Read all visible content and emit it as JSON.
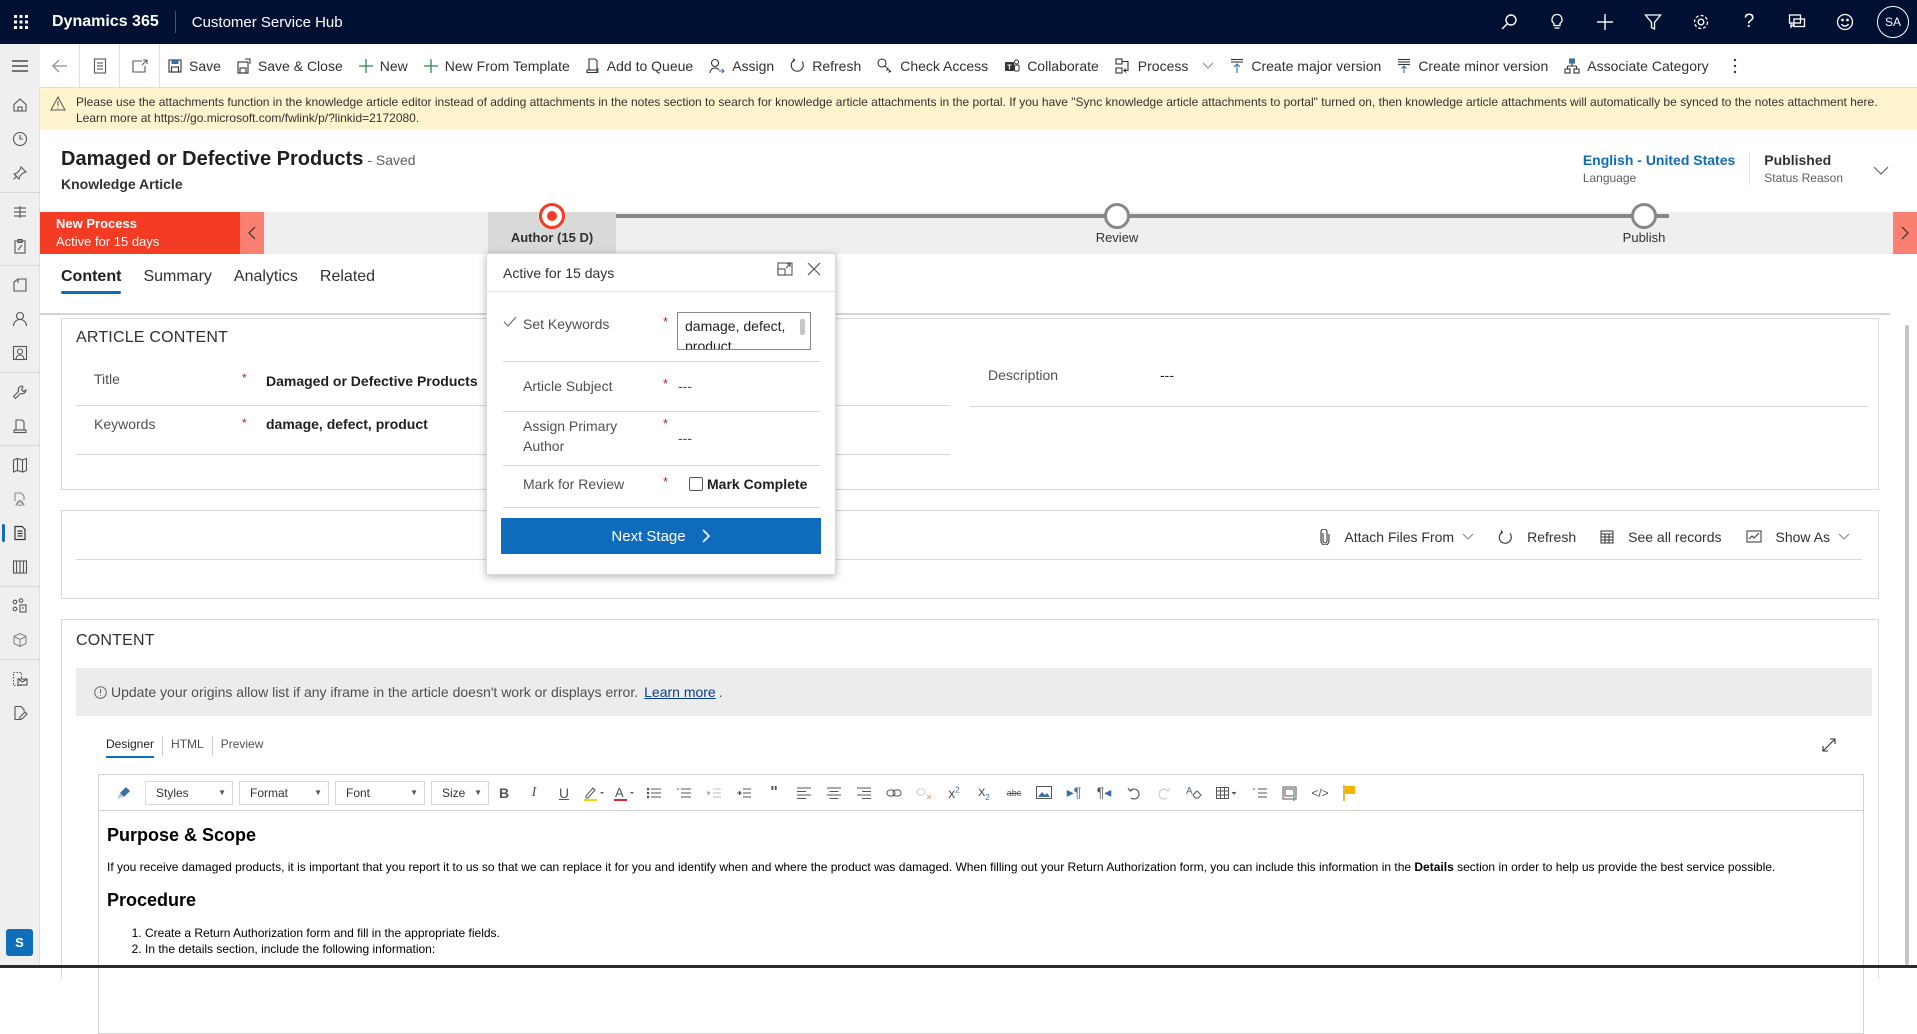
{
  "topbar": {
    "brand": "Dynamics 365",
    "app_name": "Customer Service Hub",
    "icons": [
      "search-icon",
      "lightbulb-icon",
      "plus-icon",
      "filter-icon",
      "gear-icon",
      "help-icon",
      "chat-icon",
      "smiley-icon"
    ],
    "avatar_initials": "SA"
  },
  "command_bar": {
    "items": [
      {
        "label": "Save",
        "icon": "save-icon"
      },
      {
        "label": "Save & Close",
        "icon": "save-close-icon"
      },
      {
        "label": "New",
        "icon": "plus-icon"
      },
      {
        "label": "New From Template",
        "icon": "plus-icon"
      },
      {
        "label": "Add to Queue",
        "icon": "add-queue-icon"
      },
      {
        "label": "Assign",
        "icon": "assign-icon"
      },
      {
        "label": "Refresh",
        "icon": "refresh-icon"
      },
      {
        "label": "Check Access",
        "icon": "key-icon"
      },
      {
        "label": "Collaborate",
        "icon": "teams-icon"
      },
      {
        "label": "Process",
        "icon": "process-icon"
      },
      {
        "label": "Create major version",
        "icon": "major-version-icon"
      },
      {
        "label": "Create minor version",
        "icon": "minor-version-icon"
      },
      {
        "label": "Associate Category",
        "icon": "category-icon"
      }
    ]
  },
  "banner": {
    "line1": "Please use the attachments function in the knowledge article editor instead of adding attachments in the notes section to search for knowledge article attachments in the portal. If you have \"Sync knowledge article attachments to portal\" turned on, then knowledge article attachments will automatically be synced to the notes attachment here.",
    "line2": "Learn more at https://go.microsoft.com/fwlink/p/?linkid=2172080."
  },
  "header": {
    "title": "Damaged or Defective Products",
    "saved_status": "- Saved",
    "entity": "Knowledge Article",
    "language_value": "English - United States",
    "language_label": "Language",
    "status_value": "Published",
    "status_label": "Status Reason"
  },
  "process": {
    "name": "New Process",
    "duration": "Active for 15 days",
    "stages": [
      {
        "label": "Author  (15 D)",
        "state": "active"
      },
      {
        "label": "Review",
        "state": "pending"
      },
      {
        "label": "Publish",
        "state": "pending"
      }
    ]
  },
  "tabs": [
    {
      "label": "Content",
      "active": true
    },
    {
      "label": "Summary",
      "active": false
    },
    {
      "label": "Analytics",
      "active": false
    },
    {
      "label": "Related",
      "active": false
    }
  ],
  "article_content": {
    "section_title": "ARTICLE CONTENT",
    "fields": [
      {
        "label": "Title",
        "required": "*",
        "value": "Damaged or Defective Products"
      },
      {
        "label": "Keywords",
        "required": "*",
        "value": "damage, defect, product"
      }
    ],
    "description_label": "Description",
    "description_value": "---"
  },
  "attachments_subgrid": {
    "commands": [
      {
        "label": "Attach Files From",
        "icon": "paperclip-icon",
        "has_dropdown": true
      },
      {
        "label": "Refresh",
        "icon": "refresh-icon",
        "has_dropdown": false
      },
      {
        "label": "See all records",
        "icon": "grid-icon",
        "has_dropdown": false
      },
      {
        "label": "Show As",
        "icon": "chart-icon",
        "has_dropdown": true
      }
    ]
  },
  "content_section": {
    "title": "CONTENT",
    "notice_text": "Update your origins allow list if any iframe in the article doesn't work or displays error.",
    "notice_link": "Learn more",
    "notice_suffix": ".",
    "editor_tabs": [
      {
        "label": "Designer",
        "active": true
      },
      {
        "label": "HTML",
        "active": false
      },
      {
        "label": "Preview",
        "active": false
      }
    ],
    "toolbar_dropdowns": [
      "Styles",
      "Format",
      "Font",
      "Size"
    ],
    "body": {
      "heading1": "Purpose & Scope",
      "paragraph_before": "If you receive damaged products, it is important that you report it to us so that we can replace it for you and identify when and where the product was damaged. When filling out your Return Authorization form, you can include this information in the ",
      "paragraph_bold": "Details",
      "paragraph_after": " section in order to help us provide the best service possible.",
      "heading2": "Procedure",
      "list": [
        "Create a Return Authorization form and fill in the appropriate fields.",
        "In the details section, include the following information:"
      ]
    }
  },
  "flyout": {
    "header": "Active for 15 days",
    "steps": [
      {
        "label": "Set Keywords",
        "required": "*",
        "value": "damage, defect, product",
        "completed": true
      },
      {
        "label": "Article Subject",
        "required": "*",
        "value": "---",
        "completed": false
      },
      {
        "label": "Assign Primary Author",
        "required": "*",
        "value": "---",
        "completed": false
      },
      {
        "label": "Mark for Review",
        "required": "*",
        "checkbox_label": "Mark Complete",
        "checked": false
      }
    ],
    "next_stage_label": "Next Stage"
  },
  "rail": {
    "items": [
      "home-icon",
      "recent-icon",
      "pin-icon",
      "dashboard-icon",
      "activities-icon",
      "accounts-icon",
      "contacts-icon",
      "social-profiles-icon",
      "cases-icon",
      "queues-icon",
      "knowledge-search-icon",
      "knowledge-articles-icon",
      "knowledge-base-icon",
      "incident-icon",
      "product-icon",
      "email-template-icon",
      "note-icon"
    ],
    "active_item": "knowledge-articles-icon",
    "area_badge": "S"
  }
}
